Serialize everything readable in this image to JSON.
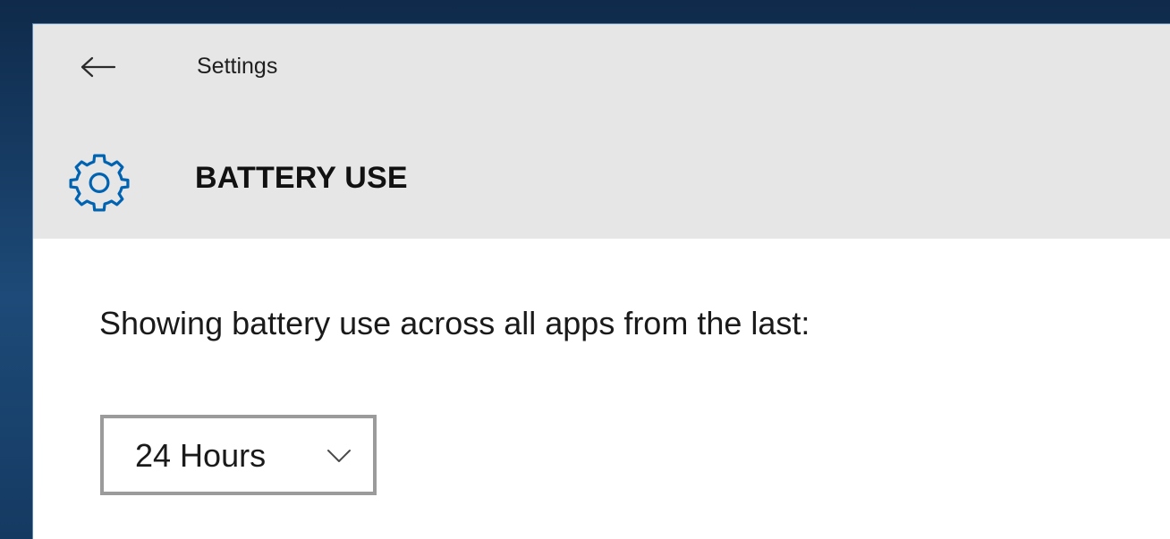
{
  "window": {
    "app_title": "Settings"
  },
  "header": {
    "page_title": "BATTERY USE",
    "icons": {
      "back": "back-arrow-icon",
      "page": "gear-icon"
    }
  },
  "content": {
    "description": "Showing battery use across all apps from the last:",
    "time_range": {
      "selected": "24 Hours",
      "icon": "chevron-down-icon"
    }
  },
  "colors": {
    "header_bg": "#e6e6e6",
    "accent": "#0063b1",
    "dropdown_border": "#9b9b9b"
  }
}
